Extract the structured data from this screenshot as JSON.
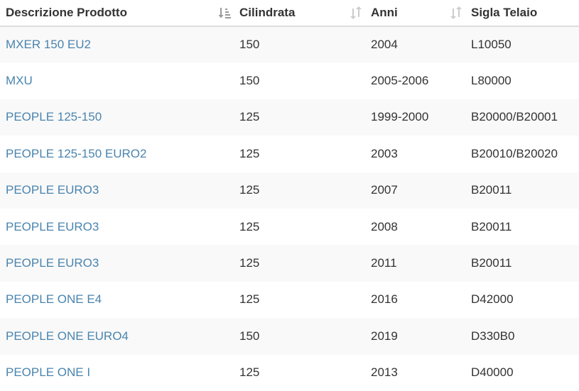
{
  "table": {
    "headers": [
      {
        "label": "Descrizione Prodotto",
        "sort": "sort-ascending-icon"
      },
      {
        "label": "Cilindrata",
        "sort": "sort-both-icon"
      },
      {
        "label": "Anni",
        "sort": "sort-both-icon"
      },
      {
        "label": "Sigla Telaio",
        "sort": ""
      }
    ],
    "rows": [
      {
        "descrizione": "MXER 150 EU2",
        "cilindrata": "150",
        "anni": "2004",
        "sigla": "L10050"
      },
      {
        "descrizione": "MXU",
        "cilindrata": "150",
        "anni": "2005-2006",
        "sigla": "L80000"
      },
      {
        "descrizione": "PEOPLE 125-150",
        "cilindrata": "125",
        "anni": "1999-2000",
        "sigla": "B20000/B20001"
      },
      {
        "descrizione": "PEOPLE 125-150 EURO2",
        "cilindrata": "125",
        "anni": "2003",
        "sigla": "B20010/B20020"
      },
      {
        "descrizione": "PEOPLE EURO3",
        "cilindrata": "125",
        "anni": "2007",
        "sigla": "B20011"
      },
      {
        "descrizione": "PEOPLE EURO3",
        "cilindrata": "125",
        "anni": "2008",
        "sigla": "B20011"
      },
      {
        "descrizione": "PEOPLE EURO3",
        "cilindrata": "125",
        "anni": "2011",
        "sigla": "B20011"
      },
      {
        "descrizione": "PEOPLE ONE E4",
        "cilindrata": "125",
        "anni": "2016",
        "sigla": "D42000"
      },
      {
        "descrizione": "PEOPLE ONE EURO4",
        "cilindrata": "150",
        "anni": "2019",
        "sigla": "D330B0"
      },
      {
        "descrizione": "PEOPLE ONE I",
        "cilindrata": "125",
        "anni": "2013",
        "sigla": "D40000"
      }
    ]
  },
  "colors": {
    "link": "#4a84ae",
    "text": "#333333",
    "stripe": "#f9f9f9",
    "header_border": "#dddddd",
    "sort_active": "#999999",
    "sort_inactive": "#cccccc"
  }
}
